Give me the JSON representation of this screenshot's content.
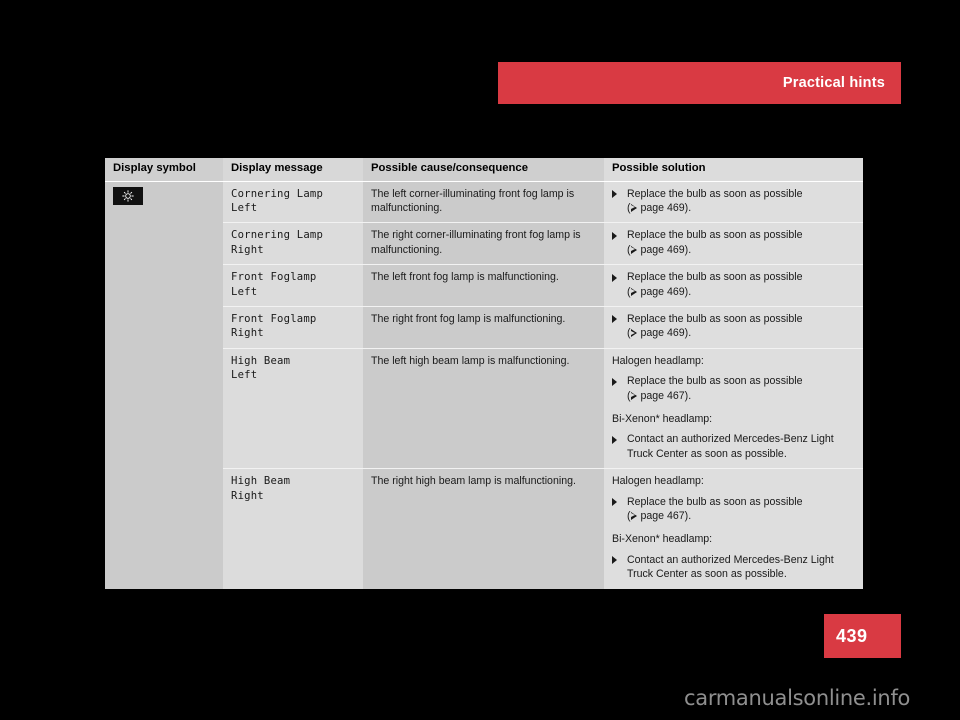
{
  "page": {
    "chapter_title": "Practical hints",
    "page_number": "439",
    "watermark": "carmanualsonline.info",
    "accent_color": "#d93a43"
  },
  "table": {
    "headers": {
      "symbol": "Display symbol",
      "message": "Display message",
      "cause": "Possible cause/consequence",
      "solution": "Possible solution"
    },
    "rows": [
      {
        "symbol_icon": "lamp-indicator-icon",
        "message_line1": "Cornering Lamp",
        "message_line2": "Left",
        "cause": "The left corner-illuminating front fog lamp is malfunctioning.",
        "solution_bullets": [
          {
            "text": "Replace the bulb as soon as possible",
            "ref_prefix": "(",
            "ref_text": " page 469).",
            "has_ref": true
          }
        ],
        "subsections": []
      },
      {
        "message_line1": "Cornering Lamp",
        "message_line2": "Right",
        "cause": "The right corner-illuminating front fog lamp is malfunctioning.",
        "solution_bullets": [
          {
            "text": "Replace the bulb as soon as possible",
            "ref_prefix": "(",
            "ref_text": " page 469).",
            "has_ref": true
          }
        ],
        "subsections": []
      },
      {
        "message_line1": "Front Foglamp",
        "message_line2": "Left",
        "cause": "The left front fog lamp is malfunctioning.",
        "solution_bullets": [
          {
            "text": "Replace the bulb as soon as possible",
            "ref_prefix": "(",
            "ref_text": " page 469).",
            "has_ref": true
          }
        ],
        "subsections": []
      },
      {
        "message_line1": "Front Foglamp",
        "message_line2": "Right",
        "cause": "The right front fog lamp is malfunctioning.",
        "solution_bullets": [
          {
            "text": "Replace the bulb as soon as possible",
            "ref_prefix": "(",
            "ref_text": " page 469).",
            "has_ref": true
          }
        ],
        "subsections": []
      },
      {
        "message_line1": "High Beam",
        "message_line2": "Left",
        "cause": "The left high beam lamp is malfunctioning.",
        "solution_bullets": [],
        "subsections": [
          {
            "heading": "Halogen headlamp:",
            "bullets": [
              {
                "text": "Replace the bulb as soon as possible",
                "ref_prefix": "(",
                "ref_text": " page 467).",
                "has_ref": true
              }
            ]
          },
          {
            "heading": "Bi-Xenon* headlamp:",
            "bullets": [
              {
                "text": "Contact an authorized Mercedes-Benz Light Truck Center as soon as possible.",
                "has_ref": false
              }
            ]
          }
        ]
      },
      {
        "message_line1": "High Beam",
        "message_line2": "Right",
        "cause": "The right high beam lamp is malfunctioning.",
        "solution_bullets": [],
        "subsections": [
          {
            "heading": "Halogen headlamp:",
            "bullets": [
              {
                "text": "Replace the bulb as soon as possible",
                "ref_prefix": "(",
                "ref_text": " page 467).",
                "has_ref": true
              }
            ]
          },
          {
            "heading": "Bi-Xenon* headlamp:",
            "bullets": [
              {
                "text": "Contact an authorized Mercedes-Benz Light Truck Center as soon as possible.",
                "has_ref": false
              }
            ]
          }
        ]
      }
    ]
  }
}
